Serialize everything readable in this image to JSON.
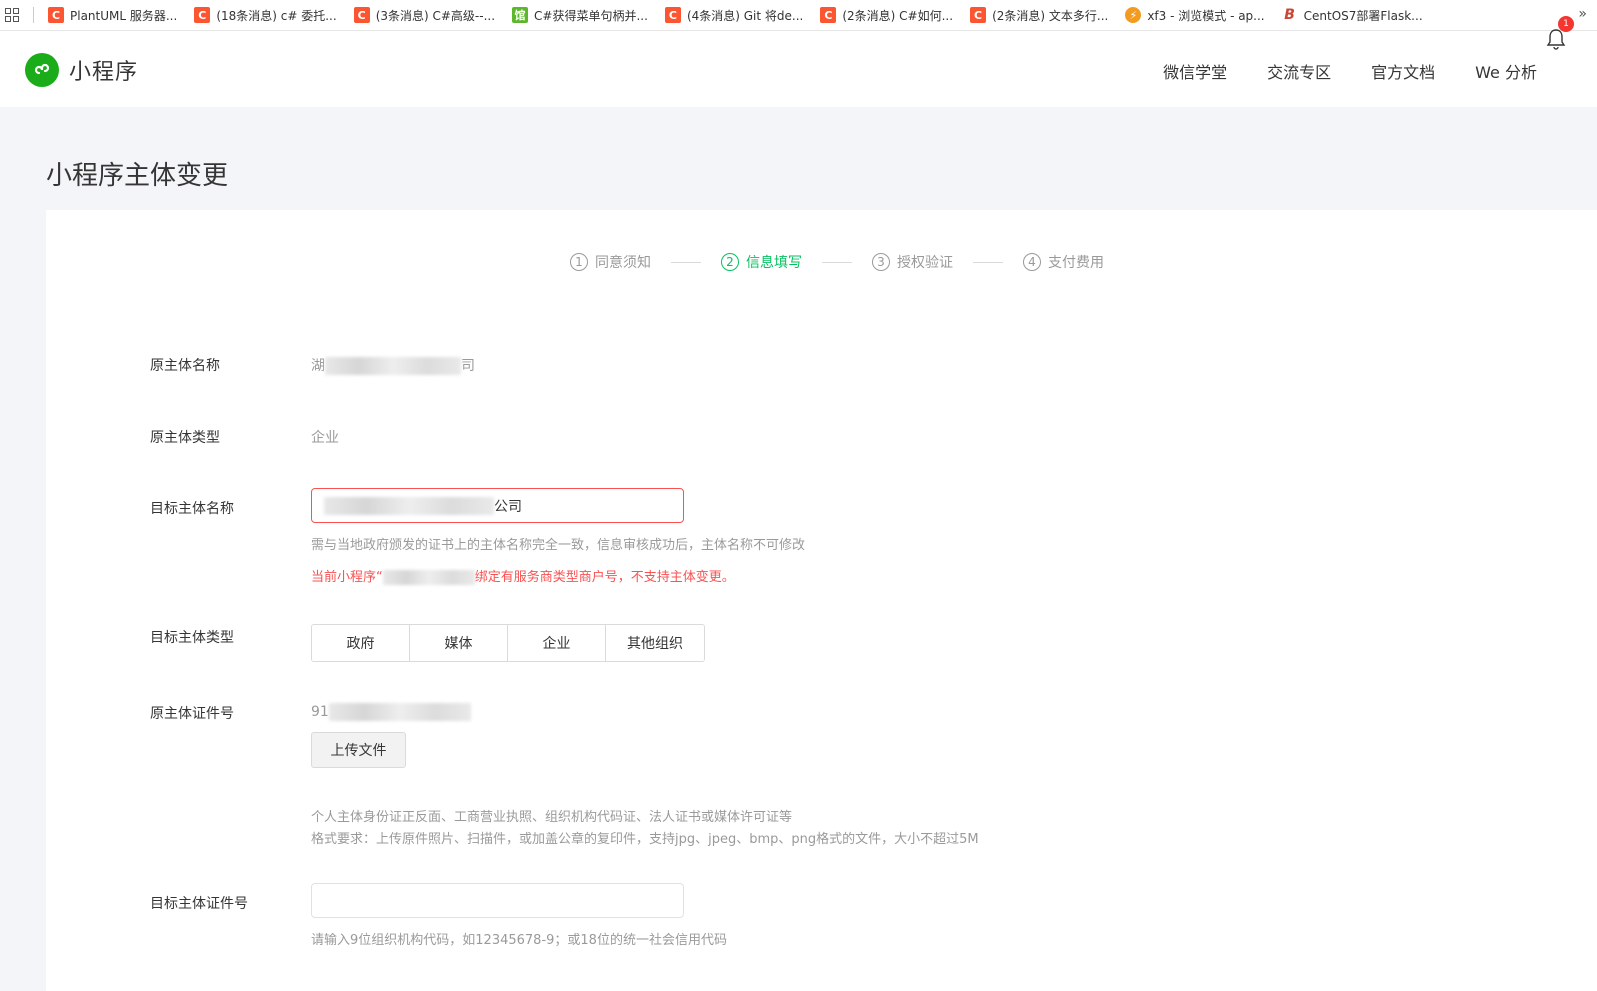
{
  "bookmarks": [
    {
      "icon": "C",
      "type": "c",
      "label": "PlantUML 服务器..."
    },
    {
      "icon": "C",
      "type": "c",
      "label": "(18条消息) c# 委托..."
    },
    {
      "icon": "C",
      "type": "c",
      "label": "(3条消息) C#高级--..."
    },
    {
      "icon": "馆",
      "type": "g",
      "label": "C#获得菜单句柄并..."
    },
    {
      "icon": "C",
      "type": "c",
      "label": "(4条消息) Git 将de..."
    },
    {
      "icon": "C",
      "type": "c",
      "label": "(2条消息) C#如何..."
    },
    {
      "icon": "C",
      "type": "c",
      "label": "(2条消息) 文本多行..."
    },
    {
      "icon": "⚡",
      "type": "o",
      "label": "xf3 - 浏览模式 - ap..."
    },
    {
      "icon": "B",
      "type": "b",
      "label": "CentOS7部署Flask..."
    }
  ],
  "bookmarks_more": "»",
  "header": {
    "logo_text": "小程序",
    "nav": [
      "微信学堂",
      "交流专区",
      "官方文档",
      "We 分析"
    ],
    "badge": "1"
  },
  "page_title": "小程序主体变更",
  "steps": [
    {
      "num": "1",
      "label": "同意须知",
      "active": false
    },
    {
      "num": "2",
      "label": "信息填写",
      "active": true
    },
    {
      "num": "3",
      "label": "授权验证",
      "active": false
    },
    {
      "num": "4",
      "label": "支付费用",
      "active": false
    }
  ],
  "form": {
    "orig_name_label": "原主体名称",
    "orig_name_prefix": "湖",
    "orig_name_suffix": "司",
    "orig_type_label": "原主体类型",
    "orig_type_value": "企业",
    "target_name_label": "目标主体名称",
    "target_name_suffix": "公司",
    "target_name_tip": "需与当地政府颁发的证书上的主体名称完全一致，信息审核成功后，主体名称不可修改",
    "target_name_error_prefix": "当前小程序“",
    "target_name_error_suffix": "绑定有服务商类型商户号，不支持主体变更。",
    "target_type_label": "目标主体类型",
    "target_type_options": [
      "政府",
      "媒体",
      "企业",
      "其他组织"
    ],
    "orig_cert_label": "原主体证件号",
    "orig_cert_prefix": "91",
    "upload_button": "上传文件",
    "upload_note_1": "个人主体身份证正反面、工商营业执照、组织机构代码证、法人证书或媒体许可证等",
    "upload_note_2": "格式要求：上传原件照片、扫描件，或加盖公章的复印件，支持jpg、jpeg、bmp、png格式的文件，大小不超过5M",
    "target_cert_label": "目标主体证件号",
    "target_cert_value": "",
    "target_cert_tip": "请输入9位组织机构代码，如12345678-9；或18位的统一社会信用代码"
  },
  "colors": {
    "accent": "#07c160",
    "error": "#fa5151",
    "logo": "#1aad19"
  }
}
